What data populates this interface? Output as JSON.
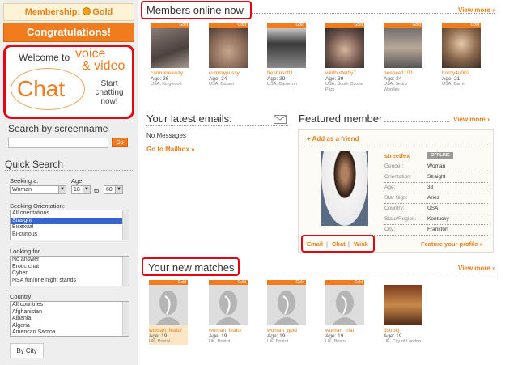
{
  "sidebar": {
    "membership_label": "Membership:",
    "membership_level": "Gold",
    "congrats": "Congratulations!",
    "chat_promo": {
      "welcome": "Welcome to",
      "voice": "voice",
      "video": "& video",
      "chat": "Chat",
      "start": "Start chatting now!"
    },
    "search_by_screenname": "Search by screenname",
    "go": "Go",
    "quick_search": "Quick Search",
    "seeking_a_label": "Seeking a:",
    "seeking_a_value": "Woman",
    "age_label": "Age:",
    "age_from": "18",
    "age_to_label": "to",
    "age_to": "60",
    "seeking_orientation_label": "Seeking Orientation:",
    "orientations": [
      "All orientations",
      "Straight",
      "Bisexual",
      "Bi-curious"
    ],
    "looking_for_label": "Looking for",
    "looking_for": [
      "No answer",
      "Erotic chat",
      "Cyber",
      "NSA fun/one night stands"
    ],
    "country_label": "Country",
    "countries": [
      "All countries",
      "Afghanistan",
      "Albania",
      "Algeria",
      "American Samoa"
    ],
    "by_city_tab": "By City"
  },
  "members_online": {
    "title": "Members online now",
    "view_more": "View more »",
    "members": [
      {
        "badge": "Gold",
        "name": "carmenesway",
        "age": "Age: 36",
        "loc": "USA, Kingwood",
        "photo": "p1"
      },
      {
        "badge": "Gold",
        "name": "cummypussy",
        "age": "Age: 24",
        "loc": "USA, Durant",
        "photo": "p2"
      },
      {
        "badge": "Gold",
        "name": "freshnsoft1",
        "age": "Age: 39",
        "loc": "USA, Cameron",
        "photo": "p3"
      },
      {
        "badge": "Gold",
        "name": "wildbutterfly7",
        "age": "Age: 39",
        "loc": "USA, South Ozone Park",
        "photo": "p4"
      },
      {
        "badge": "Gold",
        "name": "beebee1100",
        "age": "Age: 24",
        "loc": "USA, Sedro Woolley",
        "photo": "p5"
      },
      {
        "badge": "Gold",
        "name": "horny4u002",
        "age": "Age: 21",
        "loc": "USA, Barre",
        "photo": "p6"
      }
    ]
  },
  "emails": {
    "title": "Your latest emails:",
    "no_messages": "No Messages",
    "goto_mailbox": "Go to Mailbox »"
  },
  "featured": {
    "title": "Featured member",
    "view_more": "View more »",
    "add_friend": "Add as a friend",
    "username": "streetfex",
    "status": "OFFLINE",
    "fields": [
      {
        "label": "Gender:",
        "value": "Woman"
      },
      {
        "label": "Orientation:",
        "value": "Straight"
      },
      {
        "label": "Age:",
        "value": "38"
      },
      {
        "label": "Star Sign:",
        "value": "Aries"
      },
      {
        "label": "Country:",
        "value": "USA"
      },
      {
        "label": "State/Region:",
        "value": "Kentucky"
      },
      {
        "label": "City:",
        "value": "Frankfort"
      }
    ],
    "actions": [
      "Email",
      "Chat",
      "Wink"
    ],
    "feature_profile": "Feature your profile »"
  },
  "matches": {
    "title": "Your new matches",
    "view_more": "View more »",
    "members": [
      {
        "badge": "Gold",
        "name": "woman_featur",
        "age": "Age: 19",
        "loc": "UK, Bristol",
        "photo": "sil"
      },
      {
        "badge": "Gold",
        "name": "woman_featur",
        "age": "Age: 19",
        "loc": "UK, Bristol",
        "photo": "sil"
      },
      {
        "badge": "Gold",
        "name": "woman_gold",
        "age": "Age: 19",
        "loc": "UK, Bristol",
        "photo": "sil"
      },
      {
        "badge": "Gold",
        "name": "woman_trial",
        "age": "Age: 19",
        "loc": "UK, Bristol",
        "photo": "sil"
      },
      {
        "badge": "",
        "name": "dstrokj",
        "age": "Age: 19",
        "loc": "UK, City of London",
        "photo": "bar5"
      }
    ]
  }
}
